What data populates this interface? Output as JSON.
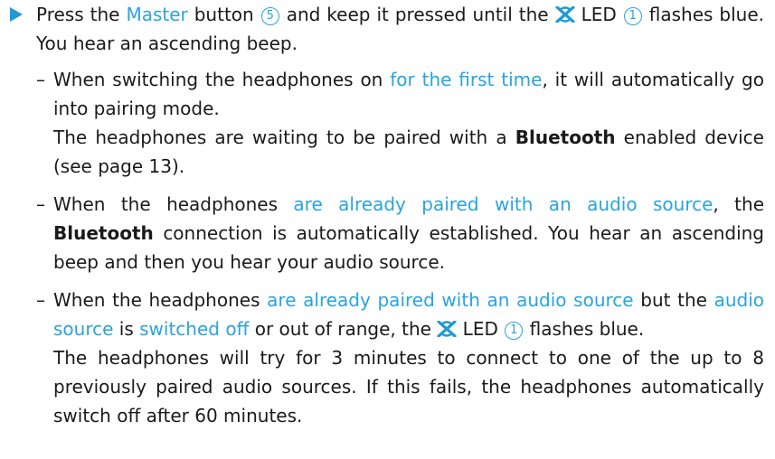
{
  "step": {
    "t1": "Press the ",
    "master": "Master",
    "t2": " button ",
    "num_button": "5",
    "t3": " and keep it pressed until the ",
    "t4": " LED ",
    "num_led": "1",
    "t5": " flashes blue. You hear an ascending beep."
  },
  "items": {
    "a": {
      "dash": "–",
      "t1": "When switching the headphones on ",
      "link": "for the first time",
      "t2": ", it will automatically go into pairing mode.",
      "p2a": "The headphones are waiting to be paired with a ",
      "bt": "Bluetooth",
      "p2b": " enabled device (see page 13)."
    },
    "b": {
      "dash": "–",
      "t1": "When the headphones ",
      "link": "are already paired with an audio source",
      "t2": ", the ",
      "bt": "Bluetooth",
      "t3": " connection is automatically established. You hear an ascending beep and then you hear your audio source."
    },
    "c": {
      "dash": "–",
      "t1": "When the headphones ",
      "link1": "are already paired with an audio source",
      "t2": " but the ",
      "link2": "audio source",
      "t3": " is ",
      "link3": "switched off",
      "t4": " or out of range, the ",
      "t5": " LED ",
      "num_led": "1",
      "t6": " flashes blue.",
      "p2": "The headphones will try for 3 minutes to connect to one of the up to 8 previously paired audio sources. If this fails, the headphones automatically switch off after 60 minutes."
    }
  },
  "colors": {
    "accent": "#2aa3de",
    "bullet": "#1f9ad6"
  },
  "icons": {
    "bullet": "triangle-bullet-icon",
    "led": "bluetooth-led-icon"
  }
}
